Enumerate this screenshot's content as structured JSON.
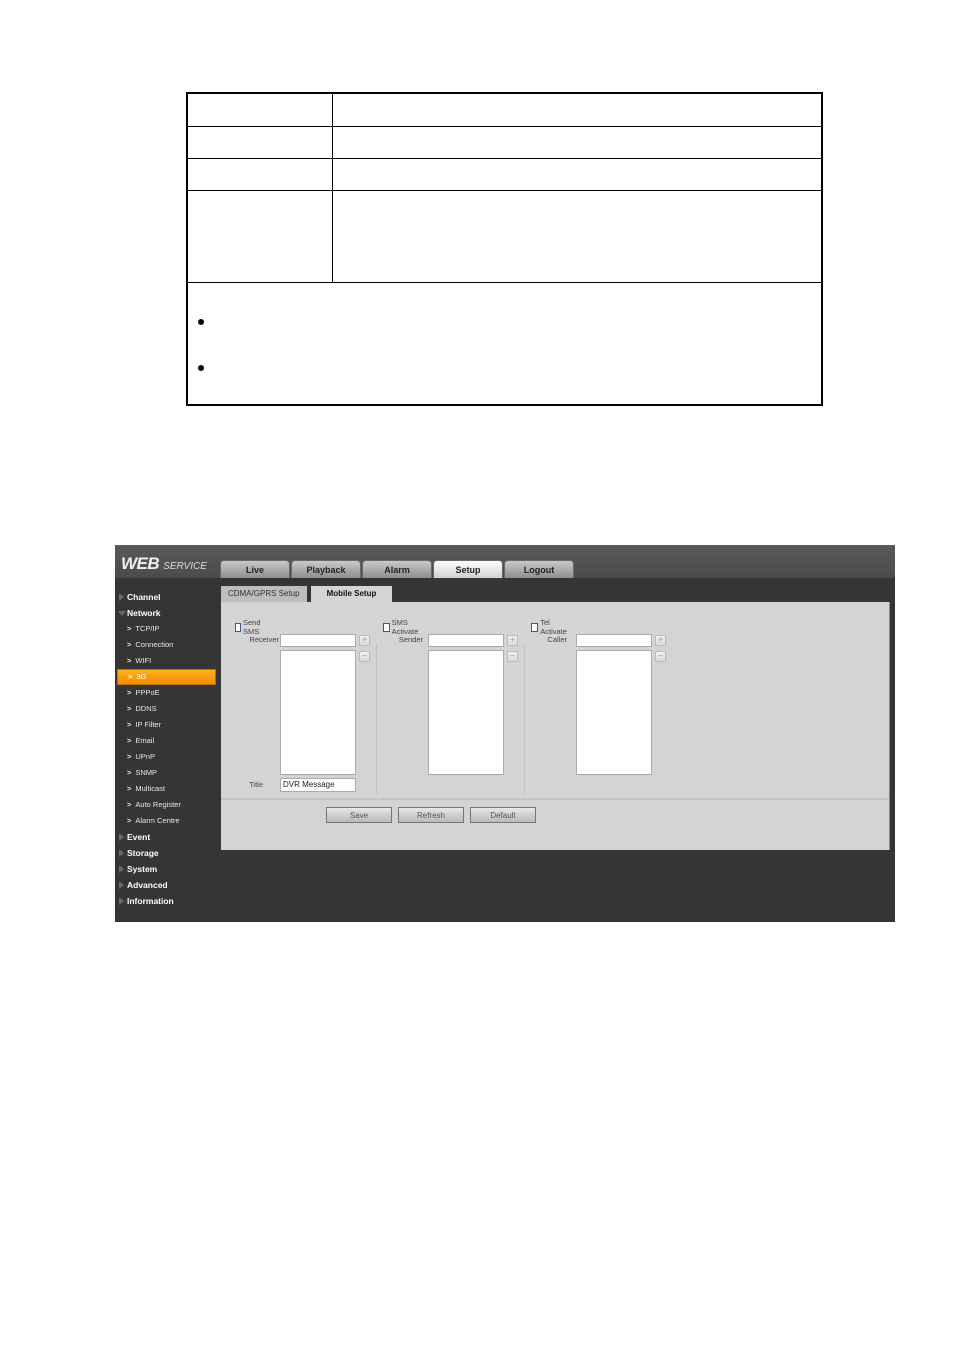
{
  "doc_table": {
    "rows": [
      {
        "label": "",
        "value": ""
      },
      {
        "label": "",
        "value": ""
      },
      {
        "label": "",
        "value": ""
      },
      {
        "label": "",
        "value": ""
      }
    ],
    "note_bullets": [
      "",
      ""
    ]
  },
  "app": {
    "logo_big": "WEB",
    "logo_small": "SERVICE",
    "main_tabs": [
      {
        "label": "Live",
        "active": false
      },
      {
        "label": "Playback",
        "active": false
      },
      {
        "label": "Alarm",
        "active": false
      },
      {
        "label": "Setup",
        "active": true
      },
      {
        "label": "Logout",
        "active": false
      }
    ],
    "sub_tabs": [
      {
        "label": "CDMA/GPRS Setup",
        "active": false
      },
      {
        "label": "Mobile Setup",
        "active": true
      }
    ],
    "sidebar": {
      "categories_top": [
        {
          "label": "Channel",
          "expanded": false
        },
        {
          "label": "Network",
          "expanded": true
        }
      ],
      "network_items": [
        {
          "label": "TCP/IP"
        },
        {
          "label": "Connection"
        },
        {
          "label": "WIFI"
        },
        {
          "label": "3G",
          "active": true
        },
        {
          "label": "PPPoE"
        },
        {
          "label": "DDNS"
        },
        {
          "label": "IP Filter"
        },
        {
          "label": "Email"
        },
        {
          "label": "UPnP"
        },
        {
          "label": "SNMP"
        },
        {
          "label": "Multicast"
        },
        {
          "label": "Auto Register"
        },
        {
          "label": "Alarm Centre"
        }
      ],
      "categories_bottom": [
        {
          "label": "Event"
        },
        {
          "label": "Storage"
        },
        {
          "label": "System"
        },
        {
          "label": "Advanced"
        },
        {
          "label": "Information"
        }
      ],
      "item_prefix": ">"
    },
    "form": {
      "send_sms": {
        "label": "Send SMS",
        "checked": false,
        "field_label": "Receiver",
        "field_value": "",
        "title_label": "Title",
        "title_value": "DVR Message"
      },
      "sms_activate": {
        "label": "SMS Activate",
        "checked": false,
        "field_label": "Sender",
        "field_value": ""
      },
      "tel_activate": {
        "label": "Tel Activate",
        "checked": false,
        "field_label": "Caller",
        "field_value": ""
      },
      "add_symbol": "+",
      "remove_symbol": "−"
    },
    "buttons": {
      "save": "Save",
      "refresh": "Refresh",
      "default": "Default"
    }
  }
}
